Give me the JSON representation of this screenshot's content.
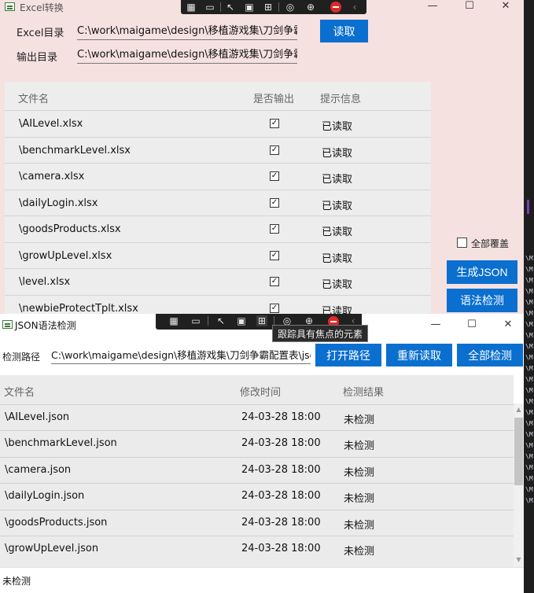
{
  "win1": {
    "title": "Excel转换",
    "excel_dir_label": "Excel目录",
    "excel_dir_value": "C:\\work\\maigame\\design\\移植游戏集\\刀剑争霸配",
    "output_dir_label": "输出目录",
    "output_dir_value": "C:\\work\\maigame\\design\\移植游戏集\\刀剑争霸配",
    "read_button": "读取",
    "columns": [
      "文件名",
      "是否输出",
      "提示信息"
    ],
    "rows": [
      {
        "file": "\\AILevel.xlsx",
        "status": "已读取"
      },
      {
        "file": "\\benchmarkLevel.xlsx",
        "status": "已读取"
      },
      {
        "file": "\\camera.xlsx",
        "status": "已读取"
      },
      {
        "file": "\\dailyLogin.xlsx",
        "status": "已读取"
      },
      {
        "file": "\\goodsProducts.xlsx",
        "status": "已读取"
      },
      {
        "file": "\\growUpLevel.xlsx",
        "status": "已读取"
      },
      {
        "file": "\\level.xlsx",
        "status": "已读取"
      },
      {
        "file": "\\newbieProtectTplt.xlsx",
        "status": "已读取"
      }
    ],
    "check_mark": "✓",
    "overwrite_all_label": "全部覆盖",
    "generate_json_button": "生成JSON",
    "syntax_check_button": "语法检测"
  },
  "win2": {
    "title": "JSON语法检测",
    "path_label": "检测路径",
    "path_value": "C:\\work\\maigame\\design\\移植游戏集\\刀剑争霸配置表\\json",
    "open_path_button": "打开路径",
    "reload_button": "重新读取",
    "check_all_button": "全部检测",
    "columns": [
      "文件名",
      "修改时间",
      "检测结果"
    ],
    "rows": [
      {
        "file": "\\AILevel.json",
        "time": "24-03-28 18:00",
        "result": "未检测"
      },
      {
        "file": "\\benchmarkLevel.json",
        "time": "24-03-28 18:00",
        "result": "未检测"
      },
      {
        "file": "\\camera.json",
        "time": "24-03-28 18:00",
        "result": "未检测"
      },
      {
        "file": "\\dailyLogin.json",
        "time": "24-03-28 18:00",
        "result": "未检测"
      },
      {
        "file": "\\goodsProducts.json",
        "time": "24-03-28 18:00",
        "result": "未检测"
      },
      {
        "file": "\\growUpLevel.json",
        "time": "24-03-28 18:00",
        "result": "未检测"
      }
    ],
    "status_text": "未检测"
  },
  "tooltip": "跟踪具有焦点的元素",
  "window_controls": {
    "minimize": "—",
    "maximize": "☐",
    "close": "✕"
  },
  "bg_strip_glyph": "\\M"
}
